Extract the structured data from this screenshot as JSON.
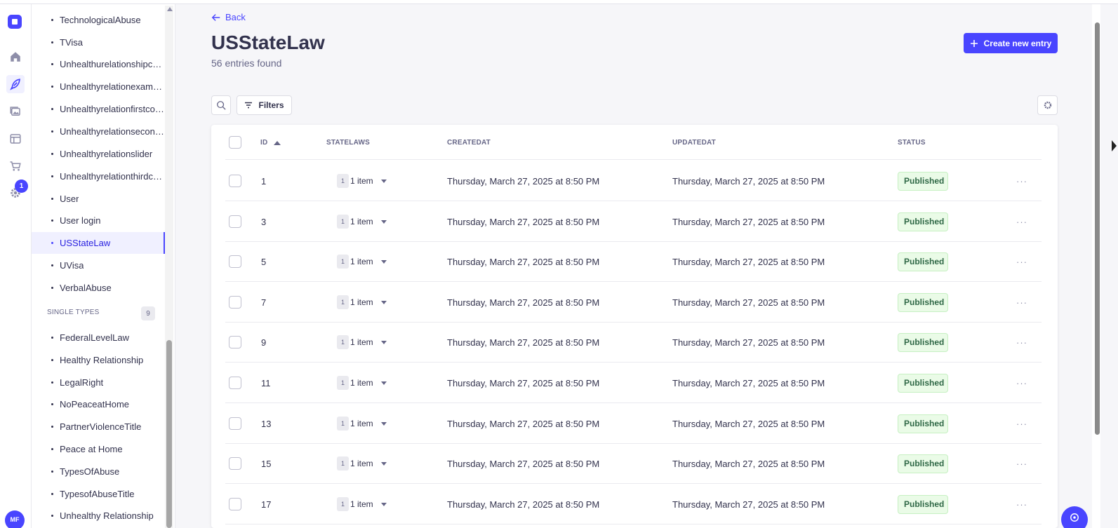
{
  "rail": {
    "logo": "strapi-logo",
    "icons": [
      "home-icon",
      "content-manager-icon",
      "media-library-icon",
      "layout-icon",
      "cart-icon",
      "settings-icon"
    ],
    "settings_badge": "1",
    "avatar": "MF"
  },
  "sidebar": {
    "collection_items": [
      {
        "label": "TechnologicalAbuse"
      },
      {
        "label": "TVisa"
      },
      {
        "label": "Unhealthurelationshipcon..."
      },
      {
        "label": "Unhealthyrelationexample"
      },
      {
        "label": "Unhealthyrelationfirstcon..."
      },
      {
        "label": "Unhealthyrelationsecond..."
      },
      {
        "label": "Unhealthyrelationslider"
      },
      {
        "label": "Unhealthyrelationthirdco..."
      },
      {
        "label": "User"
      },
      {
        "label": "User login"
      },
      {
        "label": "USStateLaw",
        "active": true
      },
      {
        "label": "UVisa"
      },
      {
        "label": "VerbalAbuse"
      }
    ],
    "single_types_title": "SINGLE TYPES",
    "single_types_count": "9",
    "single_items": [
      {
        "label": "FederalLevelLaw"
      },
      {
        "label": "Healthy Relationship"
      },
      {
        "label": "LegalRight"
      },
      {
        "label": "NoPeaceatHome"
      },
      {
        "label": "PartnerViolenceTitle"
      },
      {
        "label": "Peace at Home"
      },
      {
        "label": "TypesOfAbuse"
      },
      {
        "label": "TypesofAbuseTitle"
      },
      {
        "label": "Unhealthy Relationship"
      }
    ]
  },
  "header": {
    "back_label": "Back",
    "title": "USStateLaw",
    "subtitle": "56 entries found",
    "create_label": "Create new entry"
  },
  "toolbar": {
    "filters_label": "Filters"
  },
  "table": {
    "columns": {
      "id": "ID",
      "statelaws": "STATELAWS",
      "createdat": "CREATEDAT",
      "updatedat": "UPDATEDAT",
      "status": "STATUS"
    },
    "rows": [
      {
        "id": "1",
        "rel_count": "1",
        "rel_label": "1 item",
        "created": "Thursday, March 27, 2025 at 8:50 PM",
        "updated": "Thursday, March 27, 2025 at 8:50 PM",
        "status": "Published"
      },
      {
        "id": "3",
        "rel_count": "1",
        "rel_label": "1 item",
        "created": "Thursday, March 27, 2025 at 8:50 PM",
        "updated": "Thursday, March 27, 2025 at 8:50 PM",
        "status": "Published"
      },
      {
        "id": "5",
        "rel_count": "1",
        "rel_label": "1 item",
        "created": "Thursday, March 27, 2025 at 8:50 PM",
        "updated": "Thursday, March 27, 2025 at 8:50 PM",
        "status": "Published"
      },
      {
        "id": "7",
        "rel_count": "1",
        "rel_label": "1 item",
        "created": "Thursday, March 27, 2025 at 8:50 PM",
        "updated": "Thursday, March 27, 2025 at 8:50 PM",
        "status": "Published"
      },
      {
        "id": "9",
        "rel_count": "1",
        "rel_label": "1 item",
        "created": "Thursday, March 27, 2025 at 8:50 PM",
        "updated": "Thursday, March 27, 2025 at 8:50 PM",
        "status": "Published"
      },
      {
        "id": "11",
        "rel_count": "1",
        "rel_label": "1 item",
        "created": "Thursday, March 27, 2025 at 8:50 PM",
        "updated": "Thursday, March 27, 2025 at 8:50 PM",
        "status": "Published"
      },
      {
        "id": "13",
        "rel_count": "1",
        "rel_label": "1 item",
        "created": "Thursday, March 27, 2025 at 8:50 PM",
        "updated": "Thursday, March 27, 2025 at 8:50 PM",
        "status": "Published"
      },
      {
        "id": "15",
        "rel_count": "1",
        "rel_label": "1 item",
        "created": "Thursday, March 27, 2025 at 8:50 PM",
        "updated": "Thursday, March 27, 2025 at 8:50 PM",
        "status": "Published"
      },
      {
        "id": "17",
        "rel_count": "1",
        "rel_label": "1 item",
        "created": "Thursday, March 27, 2025 at 8:50 PM",
        "updated": "Thursday, March 27, 2025 at 8:50 PM",
        "status": "Published"
      }
    ],
    "row_action_icon": "more-icon"
  },
  "colors": {
    "primary": "#4945ff",
    "published_bg": "#eafbe7",
    "published_text": "#2f6846"
  }
}
